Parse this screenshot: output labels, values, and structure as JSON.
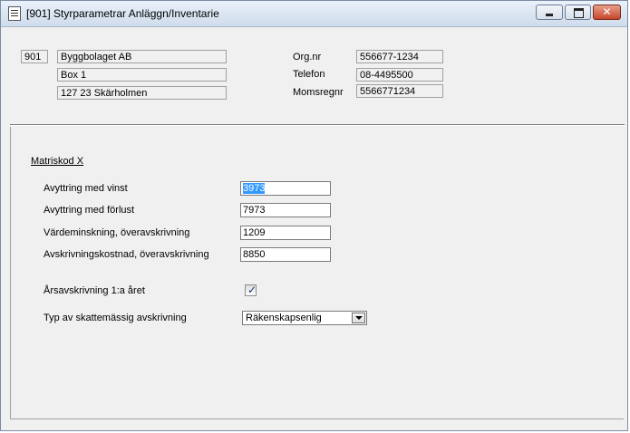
{
  "window": {
    "title": "[901]  Styrparametrar Anläggn/Inventarie",
    "icon": "document-list-icon"
  },
  "company": {
    "number": "901",
    "name": "Byggbolaget AB",
    "address": "Box 1",
    "postal": "127 23  Skärholmen",
    "orgnr_label": "Org.nr",
    "orgnr": "556677-1234",
    "phone_label": "Telefon",
    "phone": "08-4495500",
    "vat_label": "Momsregnr",
    "vat": "5566771234"
  },
  "form": {
    "section_title": "Matriskod X",
    "fields": [
      {
        "label": "Avyttring med vinst",
        "value": "3973"
      },
      {
        "label": "Avyttring med förlust",
        "value": "7973"
      },
      {
        "label": "Värdeminskning, överavskrivning",
        "value": "1209"
      },
      {
        "label": "Avskrivningskostnad, överavskrivning",
        "value": "8850"
      }
    ],
    "annual_depr_label": "Årsavskrivning 1:a året",
    "annual_depr_checked": true,
    "tax_depr_label": "Typ av skattemässig avskrivning",
    "tax_depr_value": "Räkenskapsenlig"
  }
}
